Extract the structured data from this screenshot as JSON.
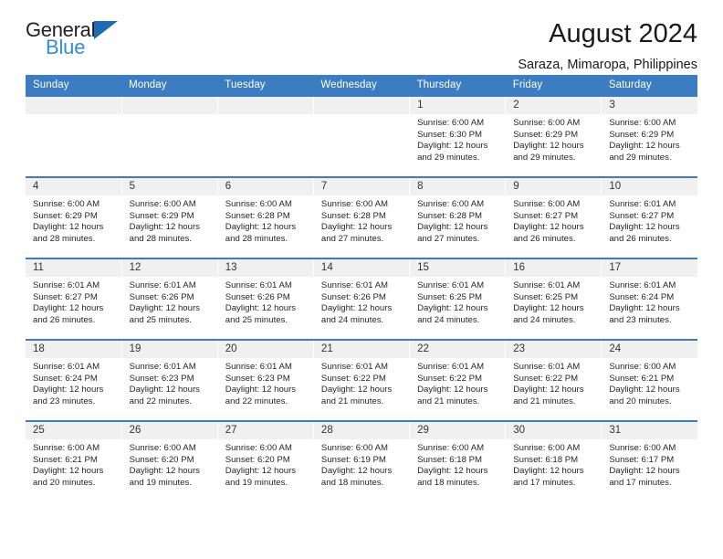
{
  "brand": {
    "name_part1": "General",
    "name_part2": "Blue",
    "accent_color": "#2f8fd6",
    "triangle_color": "#1b6cb5"
  },
  "header": {
    "title": "August 2024",
    "subtitle": "Saraza, Mimaropa, Philippines"
  },
  "calendar": {
    "header_bg": "#3b7dc0",
    "daynum_bg": "#f0f0f0",
    "weekdays": [
      "Sunday",
      "Monday",
      "Tuesday",
      "Wednesday",
      "Thursday",
      "Friday",
      "Saturday"
    ],
    "weeks": [
      [
        {
          "day": "",
          "empty": true
        },
        {
          "day": "",
          "empty": true
        },
        {
          "day": "",
          "empty": true
        },
        {
          "day": "",
          "empty": true
        },
        {
          "day": "1",
          "sunrise": "Sunrise: 6:00 AM",
          "sunset": "Sunset: 6:30 PM",
          "daylight_line1": "Daylight: 12 hours",
          "daylight_line2": "and 29 minutes."
        },
        {
          "day": "2",
          "sunrise": "Sunrise: 6:00 AM",
          "sunset": "Sunset: 6:29 PM",
          "daylight_line1": "Daylight: 12 hours",
          "daylight_line2": "and 29 minutes."
        },
        {
          "day": "3",
          "sunrise": "Sunrise: 6:00 AM",
          "sunset": "Sunset: 6:29 PM",
          "daylight_line1": "Daylight: 12 hours",
          "daylight_line2": "and 29 minutes."
        }
      ],
      [
        {
          "day": "4",
          "sunrise": "Sunrise: 6:00 AM",
          "sunset": "Sunset: 6:29 PM",
          "daylight_line1": "Daylight: 12 hours",
          "daylight_line2": "and 28 minutes."
        },
        {
          "day": "5",
          "sunrise": "Sunrise: 6:00 AM",
          "sunset": "Sunset: 6:29 PM",
          "daylight_line1": "Daylight: 12 hours",
          "daylight_line2": "and 28 minutes."
        },
        {
          "day": "6",
          "sunrise": "Sunrise: 6:00 AM",
          "sunset": "Sunset: 6:28 PM",
          "daylight_line1": "Daylight: 12 hours",
          "daylight_line2": "and 28 minutes."
        },
        {
          "day": "7",
          "sunrise": "Sunrise: 6:00 AM",
          "sunset": "Sunset: 6:28 PM",
          "daylight_line1": "Daylight: 12 hours",
          "daylight_line2": "and 27 minutes."
        },
        {
          "day": "8",
          "sunrise": "Sunrise: 6:00 AM",
          "sunset": "Sunset: 6:28 PM",
          "daylight_line1": "Daylight: 12 hours",
          "daylight_line2": "and 27 minutes."
        },
        {
          "day": "9",
          "sunrise": "Sunrise: 6:00 AM",
          "sunset": "Sunset: 6:27 PM",
          "daylight_line1": "Daylight: 12 hours",
          "daylight_line2": "and 26 minutes."
        },
        {
          "day": "10",
          "sunrise": "Sunrise: 6:01 AM",
          "sunset": "Sunset: 6:27 PM",
          "daylight_line1": "Daylight: 12 hours",
          "daylight_line2": "and 26 minutes."
        }
      ],
      [
        {
          "day": "11",
          "sunrise": "Sunrise: 6:01 AM",
          "sunset": "Sunset: 6:27 PM",
          "daylight_line1": "Daylight: 12 hours",
          "daylight_line2": "and 26 minutes."
        },
        {
          "day": "12",
          "sunrise": "Sunrise: 6:01 AM",
          "sunset": "Sunset: 6:26 PM",
          "daylight_line1": "Daylight: 12 hours",
          "daylight_line2": "and 25 minutes."
        },
        {
          "day": "13",
          "sunrise": "Sunrise: 6:01 AM",
          "sunset": "Sunset: 6:26 PM",
          "daylight_line1": "Daylight: 12 hours",
          "daylight_line2": "and 25 minutes."
        },
        {
          "day": "14",
          "sunrise": "Sunrise: 6:01 AM",
          "sunset": "Sunset: 6:26 PM",
          "daylight_line1": "Daylight: 12 hours",
          "daylight_line2": "and 24 minutes."
        },
        {
          "day": "15",
          "sunrise": "Sunrise: 6:01 AM",
          "sunset": "Sunset: 6:25 PM",
          "daylight_line1": "Daylight: 12 hours",
          "daylight_line2": "and 24 minutes."
        },
        {
          "day": "16",
          "sunrise": "Sunrise: 6:01 AM",
          "sunset": "Sunset: 6:25 PM",
          "daylight_line1": "Daylight: 12 hours",
          "daylight_line2": "and 24 minutes."
        },
        {
          "day": "17",
          "sunrise": "Sunrise: 6:01 AM",
          "sunset": "Sunset: 6:24 PM",
          "daylight_line1": "Daylight: 12 hours",
          "daylight_line2": "and 23 minutes."
        }
      ],
      [
        {
          "day": "18",
          "sunrise": "Sunrise: 6:01 AM",
          "sunset": "Sunset: 6:24 PM",
          "daylight_line1": "Daylight: 12 hours",
          "daylight_line2": "and 23 minutes."
        },
        {
          "day": "19",
          "sunrise": "Sunrise: 6:01 AM",
          "sunset": "Sunset: 6:23 PM",
          "daylight_line1": "Daylight: 12 hours",
          "daylight_line2": "and 22 minutes."
        },
        {
          "day": "20",
          "sunrise": "Sunrise: 6:01 AM",
          "sunset": "Sunset: 6:23 PM",
          "daylight_line1": "Daylight: 12 hours",
          "daylight_line2": "and 22 minutes."
        },
        {
          "day": "21",
          "sunrise": "Sunrise: 6:01 AM",
          "sunset": "Sunset: 6:22 PM",
          "daylight_line1": "Daylight: 12 hours",
          "daylight_line2": "and 21 minutes."
        },
        {
          "day": "22",
          "sunrise": "Sunrise: 6:01 AM",
          "sunset": "Sunset: 6:22 PM",
          "daylight_line1": "Daylight: 12 hours",
          "daylight_line2": "and 21 minutes."
        },
        {
          "day": "23",
          "sunrise": "Sunrise: 6:01 AM",
          "sunset": "Sunset: 6:22 PM",
          "daylight_line1": "Daylight: 12 hours",
          "daylight_line2": "and 21 minutes."
        },
        {
          "day": "24",
          "sunrise": "Sunrise: 6:00 AM",
          "sunset": "Sunset: 6:21 PM",
          "daylight_line1": "Daylight: 12 hours",
          "daylight_line2": "and 20 minutes."
        }
      ],
      [
        {
          "day": "25",
          "sunrise": "Sunrise: 6:00 AM",
          "sunset": "Sunset: 6:21 PM",
          "daylight_line1": "Daylight: 12 hours",
          "daylight_line2": "and 20 minutes."
        },
        {
          "day": "26",
          "sunrise": "Sunrise: 6:00 AM",
          "sunset": "Sunset: 6:20 PM",
          "daylight_line1": "Daylight: 12 hours",
          "daylight_line2": "and 19 minutes."
        },
        {
          "day": "27",
          "sunrise": "Sunrise: 6:00 AM",
          "sunset": "Sunset: 6:20 PM",
          "daylight_line1": "Daylight: 12 hours",
          "daylight_line2": "and 19 minutes."
        },
        {
          "day": "28",
          "sunrise": "Sunrise: 6:00 AM",
          "sunset": "Sunset: 6:19 PM",
          "daylight_line1": "Daylight: 12 hours",
          "daylight_line2": "and 18 minutes."
        },
        {
          "day": "29",
          "sunrise": "Sunrise: 6:00 AM",
          "sunset": "Sunset: 6:18 PM",
          "daylight_line1": "Daylight: 12 hours",
          "daylight_line2": "and 18 minutes."
        },
        {
          "day": "30",
          "sunrise": "Sunrise: 6:00 AM",
          "sunset": "Sunset: 6:18 PM",
          "daylight_line1": "Daylight: 12 hours",
          "daylight_line2": "and 17 minutes."
        },
        {
          "day": "31",
          "sunrise": "Sunrise: 6:00 AM",
          "sunset": "Sunset: 6:17 PM",
          "daylight_line1": "Daylight: 12 hours",
          "daylight_line2": "and 17 minutes."
        }
      ]
    ]
  }
}
